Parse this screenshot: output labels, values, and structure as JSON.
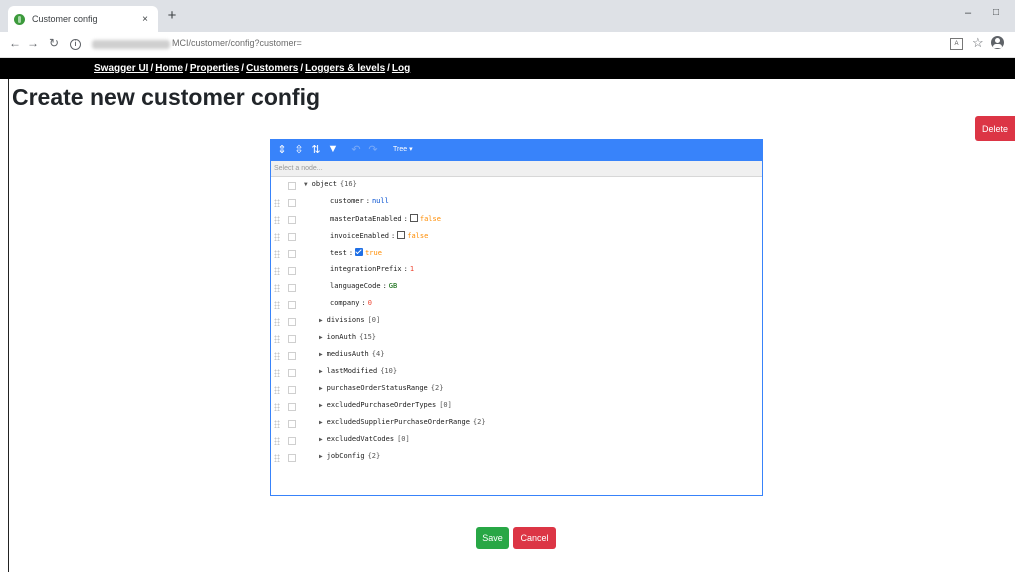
{
  "browser": {
    "tab_title": "Customer config",
    "tab_close": "×",
    "new_tab": "+",
    "minimize": "–",
    "maximize": "□",
    "url_path": "MCI/customer/config?customer="
  },
  "navbar": {
    "links": [
      "Swagger UI",
      "Home",
      "Properties",
      "Customers",
      "Loggers & levels",
      "Log"
    ],
    "separator": "/"
  },
  "page": {
    "title": "Create new customer config",
    "delete_label": "Delete",
    "save_label": "Save",
    "cancel_label": "Cancel"
  },
  "editor": {
    "mode_label": "Tree ▾",
    "search_placeholder": "Select a node...",
    "root": {
      "key": "object",
      "count": "{16}"
    },
    "nodes": [
      {
        "key": "customer",
        "value": "null",
        "type": "null"
      },
      {
        "key": "masterDataEnabled",
        "value": "false",
        "type": "bool",
        "checked": false
      },
      {
        "key": "invoiceEnabled",
        "value": "false",
        "type": "bool",
        "checked": false
      },
      {
        "key": "test",
        "value": "true",
        "type": "bool",
        "checked": true
      },
      {
        "key": "integrationPrefix",
        "value": "1",
        "type": "num"
      },
      {
        "key": "languageCode",
        "value": "GB",
        "type": "str"
      },
      {
        "key": "company",
        "value": "0",
        "type": "num"
      },
      {
        "key": "divisions",
        "count": "[0]",
        "type": "collapsed"
      },
      {
        "key": "ionAuth",
        "count": "{15}",
        "type": "collapsed"
      },
      {
        "key": "mediusAuth",
        "count": "{4}",
        "type": "collapsed"
      },
      {
        "key": "lastModified",
        "count": "{10}",
        "type": "collapsed"
      },
      {
        "key": "purchaseOrderStatusRange",
        "count": "{2}",
        "type": "collapsed"
      },
      {
        "key": "excludedPurchaseOrderTypes",
        "count": "[0]",
        "type": "collapsed"
      },
      {
        "key": "excludedSupplierPurchaseOrderRange",
        "count": "{2}",
        "type": "collapsed"
      },
      {
        "key": "excludedVatCodes",
        "count": "[0]",
        "type": "collapsed"
      },
      {
        "key": "jobConfig",
        "count": "{2}",
        "type": "collapsed"
      }
    ]
  },
  "colors": {
    "editor_accent": "#3883fa",
    "danger": "#dc3545",
    "success": "#28a745"
  }
}
